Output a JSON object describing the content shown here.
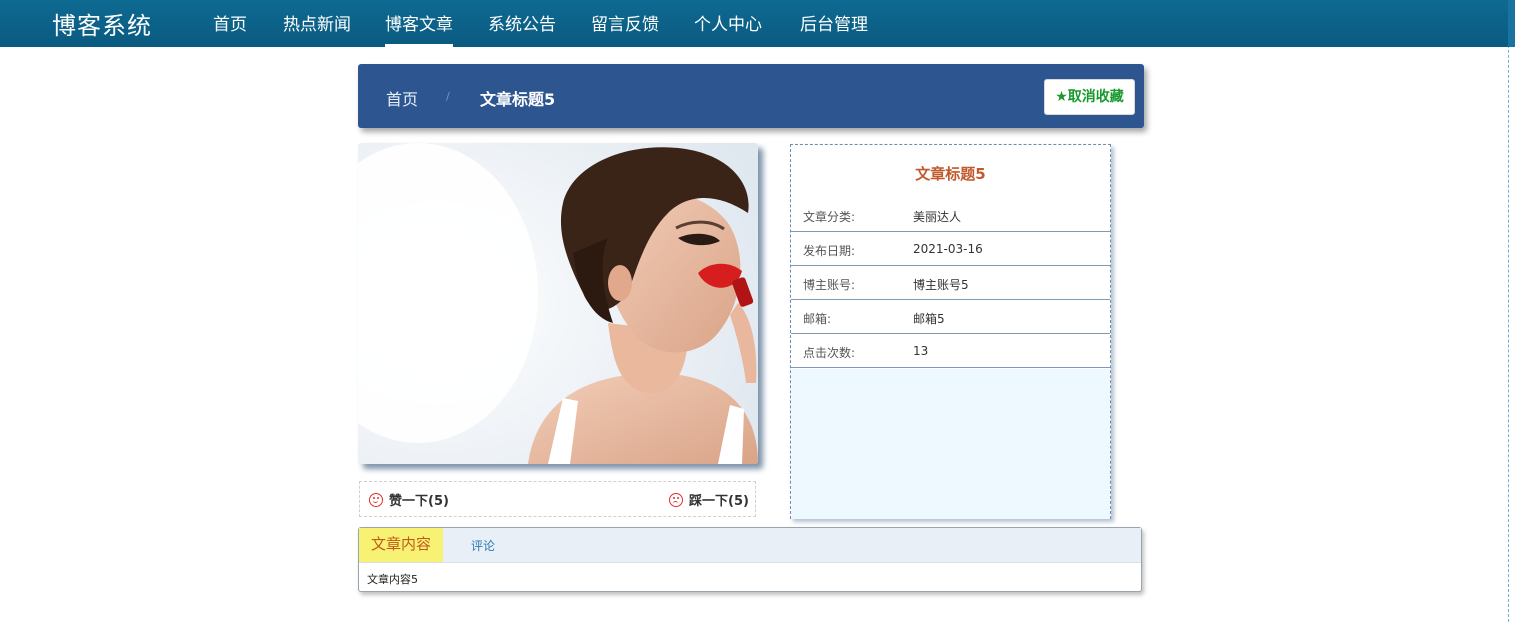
{
  "nav": {
    "logo": "博客系统",
    "items": [
      "首页",
      "热点新闻",
      "博客文章",
      "系统公告",
      "留言反馈",
      "个人中心",
      "后台管理"
    ],
    "active_index": 2
  },
  "breadcrumb": {
    "home": "首页",
    "separator": "/",
    "current": "文章标题5",
    "favorite_button": "★取消收藏"
  },
  "votes": {
    "like": "赞一下(5)",
    "dislike": "踩一下(5)"
  },
  "article_info": {
    "title": "文章标题5",
    "rows": [
      {
        "label": "文章分类:",
        "value": "美丽达人"
      },
      {
        "label": "发布日期:",
        "value": "2021-03-16"
      },
      {
        "label": "博主账号:",
        "value": "博主账号5"
      },
      {
        "label": "邮箱:",
        "value": "邮箱5"
      },
      {
        "label": "点击次数:",
        "value": "13"
      }
    ]
  },
  "tabs": {
    "active": "文章内容",
    "other": "评论",
    "content": "文章内容5"
  },
  "colors": {
    "nav_bg": "#0a5a80",
    "crumb_bg": "#2d5690",
    "info_title": "#c0592c",
    "favorite_text": "#1a9a2e",
    "tab_active_bg": "#f8f274"
  }
}
